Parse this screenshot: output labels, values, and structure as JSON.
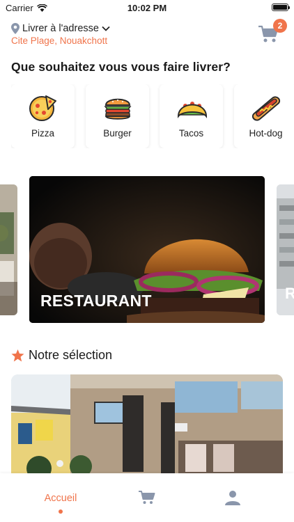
{
  "status_bar": {
    "carrier": "Carrier",
    "time": "10:02 PM"
  },
  "header": {
    "deliver_label": "Livrer à l'adresse",
    "address": "Cite Plage, Nouakchott",
    "cart_count": "2"
  },
  "section_title": "Que souhaitez vous vous faire livrer?",
  "categories": [
    {
      "label": "Pizza",
      "icon": "pizza-icon"
    },
    {
      "label": "Burger",
      "icon": "burger-icon"
    },
    {
      "label": "Tacos",
      "icon": "taco-icon"
    },
    {
      "label": "Hot-dog",
      "icon": "hotdog-icon"
    }
  ],
  "banners": {
    "main_label": "RESTAURANT",
    "side_label": "R"
  },
  "selection": {
    "title": "Notre sélection"
  },
  "bottom_nav": {
    "home_label": "Accueil"
  },
  "colors": {
    "accent": "#f0744b",
    "icon_gray": "#8a96ab"
  }
}
